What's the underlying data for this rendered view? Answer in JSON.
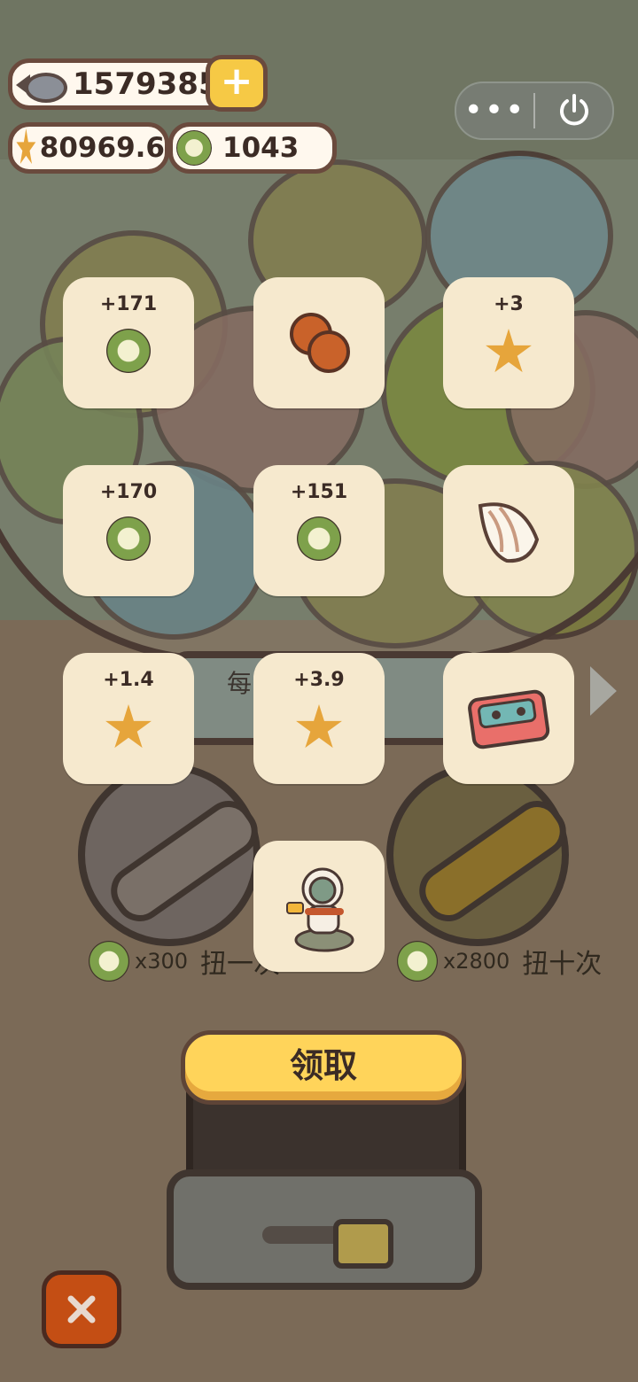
{
  "hud": {
    "fish_count": "15793859",
    "star_count": "80969.6",
    "coin_count": "1043"
  },
  "machine": {
    "window_text": "每          20",
    "single_spin": {
      "cost": "x300",
      "label": "扭一次"
    },
    "ten_spin": {
      "cost": "x2800",
      "label": "扭十次"
    }
  },
  "rewards": [
    {
      "amount": "+171",
      "icon": "coin-icon"
    },
    {
      "amount": "",
      "icon": "meatball-icon"
    },
    {
      "amount": "+3",
      "icon": "star-icon"
    },
    {
      "amount": "+170",
      "icon": "coin-icon"
    },
    {
      "amount": "+151",
      "icon": "coin-icon"
    },
    {
      "amount": "",
      "icon": "seashell-icon"
    },
    {
      "amount": "+1.4",
      "icon": "star-icon"
    },
    {
      "amount": "+3.9",
      "icon": "star-icon"
    },
    {
      "amount": "",
      "icon": "cassette-tape-icon"
    },
    {
      "amount": "",
      "icon": "astronaut-duck-figurine-icon"
    }
  ],
  "actions": {
    "claim_label": "领取"
  },
  "colors": {
    "tile_bg": "#f6e9ce",
    "claim_button": "#ffd45a",
    "close_button": "#c44e14",
    "coin_green": "#7ea14b",
    "star_orange": "#e6a53b"
  }
}
